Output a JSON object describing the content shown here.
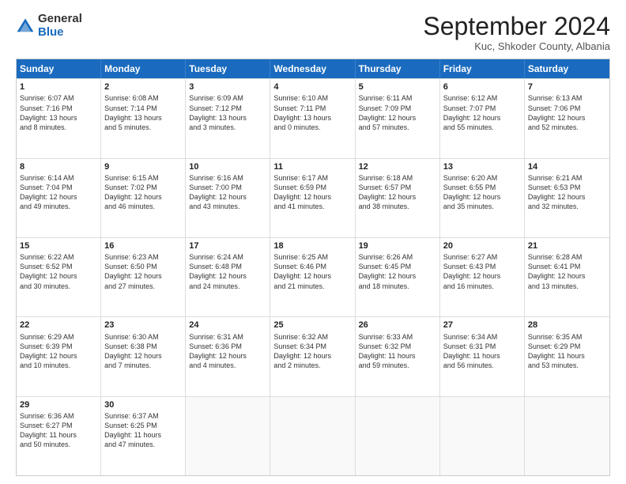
{
  "logo": {
    "general": "General",
    "blue": "Blue"
  },
  "title": "September 2024",
  "location": "Kuc, Shkoder County, Albania",
  "header_days": [
    "Sunday",
    "Monday",
    "Tuesday",
    "Wednesday",
    "Thursday",
    "Friday",
    "Saturday"
  ],
  "weeks": [
    [
      {
        "day": "1",
        "lines": [
          "Sunrise: 6:07 AM",
          "Sunset: 7:16 PM",
          "Daylight: 13 hours",
          "and 8 minutes."
        ]
      },
      {
        "day": "2",
        "lines": [
          "Sunrise: 6:08 AM",
          "Sunset: 7:14 PM",
          "Daylight: 13 hours",
          "and 5 minutes."
        ]
      },
      {
        "day": "3",
        "lines": [
          "Sunrise: 6:09 AM",
          "Sunset: 7:12 PM",
          "Daylight: 13 hours",
          "and 3 minutes."
        ]
      },
      {
        "day": "4",
        "lines": [
          "Sunrise: 6:10 AM",
          "Sunset: 7:11 PM",
          "Daylight: 13 hours",
          "and 0 minutes."
        ]
      },
      {
        "day": "5",
        "lines": [
          "Sunrise: 6:11 AM",
          "Sunset: 7:09 PM",
          "Daylight: 12 hours",
          "and 57 minutes."
        ]
      },
      {
        "day": "6",
        "lines": [
          "Sunrise: 6:12 AM",
          "Sunset: 7:07 PM",
          "Daylight: 12 hours",
          "and 55 minutes."
        ]
      },
      {
        "day": "7",
        "lines": [
          "Sunrise: 6:13 AM",
          "Sunset: 7:06 PM",
          "Daylight: 12 hours",
          "and 52 minutes."
        ]
      }
    ],
    [
      {
        "day": "8",
        "lines": [
          "Sunrise: 6:14 AM",
          "Sunset: 7:04 PM",
          "Daylight: 12 hours",
          "and 49 minutes."
        ]
      },
      {
        "day": "9",
        "lines": [
          "Sunrise: 6:15 AM",
          "Sunset: 7:02 PM",
          "Daylight: 12 hours",
          "and 46 minutes."
        ]
      },
      {
        "day": "10",
        "lines": [
          "Sunrise: 6:16 AM",
          "Sunset: 7:00 PM",
          "Daylight: 12 hours",
          "and 43 minutes."
        ]
      },
      {
        "day": "11",
        "lines": [
          "Sunrise: 6:17 AM",
          "Sunset: 6:59 PM",
          "Daylight: 12 hours",
          "and 41 minutes."
        ]
      },
      {
        "day": "12",
        "lines": [
          "Sunrise: 6:18 AM",
          "Sunset: 6:57 PM",
          "Daylight: 12 hours",
          "and 38 minutes."
        ]
      },
      {
        "day": "13",
        "lines": [
          "Sunrise: 6:20 AM",
          "Sunset: 6:55 PM",
          "Daylight: 12 hours",
          "and 35 minutes."
        ]
      },
      {
        "day": "14",
        "lines": [
          "Sunrise: 6:21 AM",
          "Sunset: 6:53 PM",
          "Daylight: 12 hours",
          "and 32 minutes."
        ]
      }
    ],
    [
      {
        "day": "15",
        "lines": [
          "Sunrise: 6:22 AM",
          "Sunset: 6:52 PM",
          "Daylight: 12 hours",
          "and 30 minutes."
        ]
      },
      {
        "day": "16",
        "lines": [
          "Sunrise: 6:23 AM",
          "Sunset: 6:50 PM",
          "Daylight: 12 hours",
          "and 27 minutes."
        ]
      },
      {
        "day": "17",
        "lines": [
          "Sunrise: 6:24 AM",
          "Sunset: 6:48 PM",
          "Daylight: 12 hours",
          "and 24 minutes."
        ]
      },
      {
        "day": "18",
        "lines": [
          "Sunrise: 6:25 AM",
          "Sunset: 6:46 PM",
          "Daylight: 12 hours",
          "and 21 minutes."
        ]
      },
      {
        "day": "19",
        "lines": [
          "Sunrise: 6:26 AM",
          "Sunset: 6:45 PM",
          "Daylight: 12 hours",
          "and 18 minutes."
        ]
      },
      {
        "day": "20",
        "lines": [
          "Sunrise: 6:27 AM",
          "Sunset: 6:43 PM",
          "Daylight: 12 hours",
          "and 16 minutes."
        ]
      },
      {
        "day": "21",
        "lines": [
          "Sunrise: 6:28 AM",
          "Sunset: 6:41 PM",
          "Daylight: 12 hours",
          "and 13 minutes."
        ]
      }
    ],
    [
      {
        "day": "22",
        "lines": [
          "Sunrise: 6:29 AM",
          "Sunset: 6:39 PM",
          "Daylight: 12 hours",
          "and 10 minutes."
        ]
      },
      {
        "day": "23",
        "lines": [
          "Sunrise: 6:30 AM",
          "Sunset: 6:38 PM",
          "Daylight: 12 hours",
          "and 7 minutes."
        ]
      },
      {
        "day": "24",
        "lines": [
          "Sunrise: 6:31 AM",
          "Sunset: 6:36 PM",
          "Daylight: 12 hours",
          "and 4 minutes."
        ]
      },
      {
        "day": "25",
        "lines": [
          "Sunrise: 6:32 AM",
          "Sunset: 6:34 PM",
          "Daylight: 12 hours",
          "and 2 minutes."
        ]
      },
      {
        "day": "26",
        "lines": [
          "Sunrise: 6:33 AM",
          "Sunset: 6:32 PM",
          "Daylight: 11 hours",
          "and 59 minutes."
        ]
      },
      {
        "day": "27",
        "lines": [
          "Sunrise: 6:34 AM",
          "Sunset: 6:31 PM",
          "Daylight: 11 hours",
          "and 56 minutes."
        ]
      },
      {
        "day": "28",
        "lines": [
          "Sunrise: 6:35 AM",
          "Sunset: 6:29 PM",
          "Daylight: 11 hours",
          "and 53 minutes."
        ]
      }
    ],
    [
      {
        "day": "29",
        "lines": [
          "Sunrise: 6:36 AM",
          "Sunset: 6:27 PM",
          "Daylight: 11 hours",
          "and 50 minutes."
        ]
      },
      {
        "day": "30",
        "lines": [
          "Sunrise: 6:37 AM",
          "Sunset: 6:25 PM",
          "Daylight: 11 hours",
          "and 47 minutes."
        ]
      },
      {
        "day": "",
        "lines": []
      },
      {
        "day": "",
        "lines": []
      },
      {
        "day": "",
        "lines": []
      },
      {
        "day": "",
        "lines": []
      },
      {
        "day": "",
        "lines": []
      }
    ]
  ]
}
